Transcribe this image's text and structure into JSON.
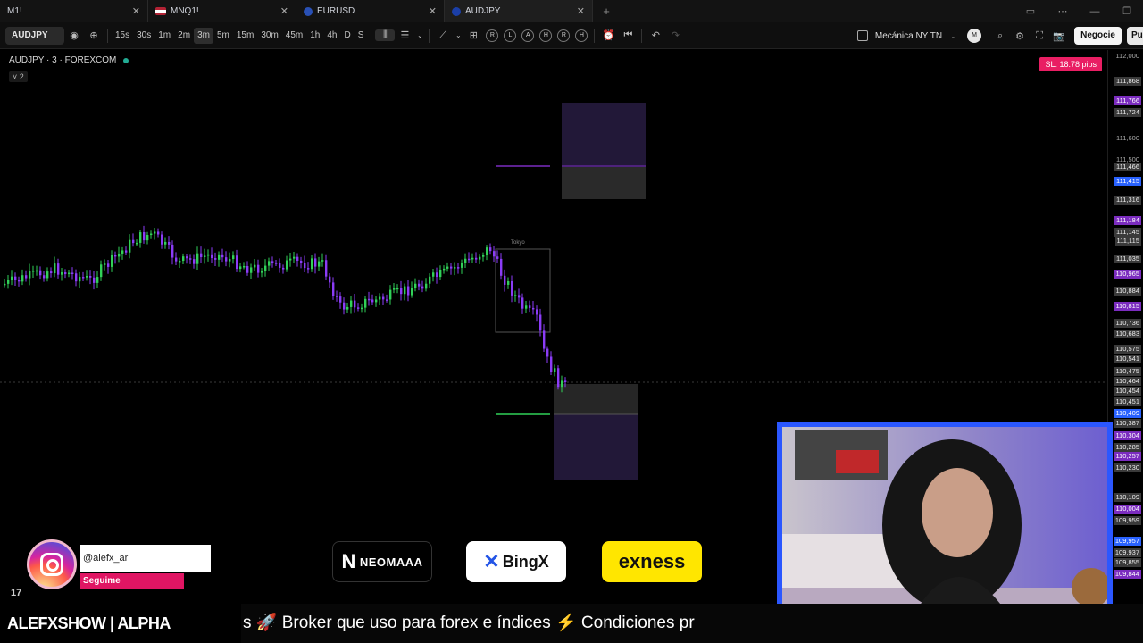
{
  "tabs": [
    {
      "label": "M1!",
      "flag": "",
      "active": false
    },
    {
      "label": "MNQ1!",
      "flag": "us",
      "active": false
    },
    {
      "label": "EURUSD",
      "flag": "eu",
      "active": false
    },
    {
      "label": "AUDJPY",
      "flag": "au",
      "active": true
    }
  ],
  "toolbar": {
    "symbol": "AUDJPY",
    "timeframes": [
      "15s",
      "30s",
      "1m",
      "2m",
      "3m",
      "5m",
      "15m",
      "30m",
      "45m",
      "1h",
      "4h",
      "D",
      "S"
    ],
    "active_timeframe": "3m",
    "session_buttons": [
      "R",
      "L",
      "A",
      "H",
      "R",
      "H"
    ],
    "layout_name": "Mecánica NY TN",
    "avatar_letter": "M",
    "trade_label": "Negocie",
    "publish_label": "Pu"
  },
  "chart": {
    "legend": "AUDJPY · 3 · FOREXCOM",
    "indicator_count": "˅ 2",
    "sl_badge": "SL: 18.78 pips",
    "session_label": "Tokyo",
    "colors": {
      "bull": "#31d158",
      "bear": "#8b3cf7",
      "zone_purple": "#221838",
      "zone_gray": "#2a2a2a"
    }
  },
  "price_axis": [
    {
      "v": "112,000",
      "style": ""
    },
    {
      "v": "111,868",
      "style": "gray"
    },
    {
      "v": "111,766",
      "style": "purple"
    },
    {
      "v": "111,724",
      "style": "gray"
    },
    {
      "v": "111,600",
      "style": ""
    },
    {
      "v": "111,500",
      "style": ""
    },
    {
      "v": "111,466",
      "style": "gray"
    },
    {
      "v": "111,415",
      "style": "blue"
    },
    {
      "v": "111,316",
      "style": "gray"
    },
    {
      "v": "111,184",
      "style": "purple"
    },
    {
      "v": "111,145",
      "style": "gray"
    },
    {
      "v": "111,115",
      "style": "gray"
    },
    {
      "v": "111,035",
      "style": "gray"
    },
    {
      "v": "110,965",
      "style": "purple"
    },
    {
      "v": "110,884",
      "style": "gray"
    },
    {
      "v": "110,815",
      "style": "purple"
    },
    {
      "v": "110,736",
      "style": "gray"
    },
    {
      "v": "110,683",
      "style": "gray"
    },
    {
      "v": "110,575",
      "style": "gray"
    },
    {
      "v": "110,541",
      "style": "gray"
    },
    {
      "v": "110,475",
      "style": "gray"
    },
    {
      "v": "110,464",
      "style": "gray"
    },
    {
      "v": "110,454",
      "style": "gray"
    },
    {
      "v": "110,451",
      "style": "gray"
    },
    {
      "v": "110,409",
      "style": "blue"
    },
    {
      "v": "110,387",
      "style": "gray"
    },
    {
      "v": "110,304",
      "style": "purple"
    },
    {
      "v": "110,285",
      "style": "gray"
    },
    {
      "v": "110,257",
      "style": "purple"
    },
    {
      "v": "110,230",
      "style": "gray"
    },
    {
      "v": "110,109",
      "style": "gray"
    },
    {
      "v": "110,004",
      "style": "purple"
    },
    {
      "v": "109,959",
      "style": "gray"
    },
    {
      "v": "109,957",
      "style": "blue"
    },
    {
      "v": "109,937",
      "style": "gray"
    },
    {
      "v": "109,855",
      "style": "gray"
    },
    {
      "v": "109,844",
      "style": "purple"
    }
  ],
  "overlay": {
    "instagram_handle": "@alefx_ar",
    "instagram_cta": "Seguime",
    "sponsors": [
      "NEOMAAA",
      "BingX",
      "exness"
    ],
    "ticker_brand": "ALEFXSHOW | ALPHA TRADERS",
    "ticker_text": "s 🚀 Broker que uso para forex e índices ⚡ Condiciones pr",
    "tv_logo": "17"
  }
}
